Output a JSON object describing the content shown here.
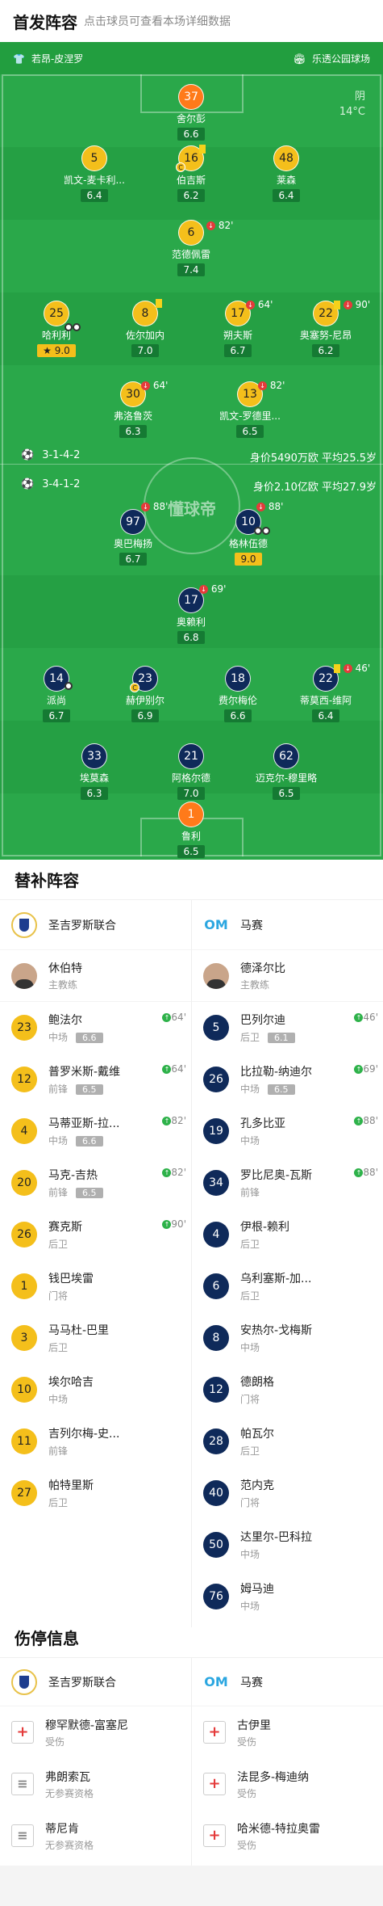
{
  "header": {
    "title": "首发阵容",
    "subtitle": "点击球员可查看本场详细数据"
  },
  "pitch": {
    "home_team_short": "若昂-皮涅罗",
    "venue": "乐透公园球场",
    "weather": "阴",
    "temperature": "14°C",
    "watermark": "懂球帝",
    "home_formation": "3-1-4-2",
    "away_formation": "3-4-1-2",
    "home_stats": "身价5490万欧  平均25.5岁",
    "away_stats": "身价2.10亿欧  平均27.9岁"
  },
  "home_players": [
    {
      "num": "37",
      "name": "舍尔彭",
      "rating": "6.6"
    },
    {
      "num": "5",
      "name": "凯文-麦卡利...",
      "rating": "6.4"
    },
    {
      "num": "16",
      "name": "伯吉斯",
      "rating": "6.2"
    },
    {
      "num": "48",
      "name": "莱森",
      "rating": "6.4"
    },
    {
      "num": "6",
      "name": "范德佩雷",
      "rating": "7.4",
      "event": "82'"
    },
    {
      "num": "25",
      "name": "哈利利",
      "rating": "9.0"
    },
    {
      "num": "8",
      "name": "佐尔加内",
      "rating": "7.0"
    },
    {
      "num": "17",
      "name": "朔夫斯",
      "rating": "6.7",
      "event": "64'"
    },
    {
      "num": "22",
      "name": "奥塞努-尼昂",
      "rating": "6.2",
      "event": "90'"
    },
    {
      "num": "30",
      "name": "弗洛鲁茨",
      "rating": "6.3",
      "event": "64'"
    },
    {
      "num": "13",
      "name": "凯文-罗德里...",
      "rating": "6.5",
      "event": "82'"
    }
  ],
  "away_players": [
    {
      "num": "97",
      "name": "奥巴梅扬",
      "rating": "6.7",
      "event": "88'"
    },
    {
      "num": "10",
      "name": "格林伍德",
      "rating": "9.0",
      "event": "88'"
    },
    {
      "num": "17",
      "name": "奥赖利",
      "rating": "6.8",
      "event": "69'"
    },
    {
      "num": "14",
      "name": "派尚",
      "rating": "6.7"
    },
    {
      "num": "23",
      "name": "赫伊别尔",
      "rating": "6.9"
    },
    {
      "num": "18",
      "name": "费尔梅伦",
      "rating": "6.6"
    },
    {
      "num": "22",
      "name": "蒂莫西-维阿",
      "rating": "6.4",
      "event": "46'"
    },
    {
      "num": "33",
      "name": "埃莫森",
      "rating": "6.3"
    },
    {
      "num": "21",
      "name": "阿格尔德",
      "rating": "7.0"
    },
    {
      "num": "62",
      "name": "迈克尔-穆里略",
      "rating": "6.5"
    },
    {
      "num": "1",
      "name": "鲁利",
      "rating": "6.5"
    }
  ],
  "subs": {
    "title": "替补阵容",
    "home_team": "圣吉罗斯联合",
    "away_team": "马赛",
    "away_logo": "OM",
    "home_coach": {
      "name": "休伯特",
      "role": "主教练"
    },
    "away_coach": {
      "name": "德泽尔比",
      "role": "主教练"
    },
    "home": [
      {
        "num": "23",
        "name": "鲍法尔",
        "pos": "中场",
        "rating": "6.6",
        "in": "64'"
      },
      {
        "num": "12",
        "name": "普罗米斯-戴维",
        "pos": "前锋",
        "rating": "6.5",
        "in": "64'"
      },
      {
        "num": "4",
        "name": "马蒂亚斯-拉...",
        "pos": "中场",
        "rating": "6.6",
        "in": "82'"
      },
      {
        "num": "20",
        "name": "马克-吉热",
        "pos": "前锋",
        "rating": "6.5",
        "in": "82'"
      },
      {
        "num": "26",
        "name": "赛克斯",
        "pos": "后卫",
        "in": "90'"
      },
      {
        "num": "1",
        "name": "钱巴埃雷",
        "pos": "门将"
      },
      {
        "num": "3",
        "name": "马马杜-巴里",
        "pos": "后卫"
      },
      {
        "num": "10",
        "name": "埃尔哈吉",
        "pos": "中场"
      },
      {
        "num": "11",
        "name": "吉列尔梅-史...",
        "pos": "前锋"
      },
      {
        "num": "27",
        "name": "帕特里斯",
        "pos": "后卫"
      }
    ],
    "away": [
      {
        "num": "5",
        "name": "巴列尔迪",
        "pos": "后卫",
        "rating": "6.1",
        "in": "46'"
      },
      {
        "num": "26",
        "name": "比拉勒-纳迪尔",
        "pos": "中场",
        "rating": "6.5",
        "in": "69'"
      },
      {
        "num": "19",
        "name": "孔多比亚",
        "pos": "中场",
        "in": "88'"
      },
      {
        "num": "34",
        "name": "罗比尼奥-瓦斯",
        "pos": "前锋",
        "in": "88'"
      },
      {
        "num": "4",
        "name": "伊根-赖利",
        "pos": "后卫"
      },
      {
        "num": "6",
        "name": "乌利塞斯-加...",
        "pos": "后卫"
      },
      {
        "num": "8",
        "name": "安热尔-戈梅斯",
        "pos": "中场"
      },
      {
        "num": "12",
        "name": "德朗格",
        "pos": "门将"
      },
      {
        "num": "28",
        "name": "帕瓦尔",
        "pos": "后卫"
      },
      {
        "num": "40",
        "name": "范内克",
        "pos": "门将"
      },
      {
        "num": "50",
        "name": "达里尔-巴科拉",
        "pos": "中场"
      },
      {
        "num": "76",
        "name": "姆马迪",
        "pos": "中场"
      }
    ]
  },
  "injuries": {
    "title": "伤停信息",
    "home": [
      {
        "name": "穆罕默德-富塞尼",
        "status": "受伤",
        "type": "injury"
      },
      {
        "name": "弗朗索瓦",
        "status": "无参赛资格",
        "type": "ineligible"
      },
      {
        "name": "蒂尼肯",
        "status": "无参赛资格",
        "type": "ineligible"
      }
    ],
    "away": [
      {
        "name": "古伊里",
        "status": "受伤",
        "type": "injury"
      },
      {
        "name": "法昆多-梅迪纳",
        "status": "受伤",
        "type": "injury"
      },
      {
        "name": "哈米德-特拉奥雷",
        "status": "受伤",
        "type": "injury"
      }
    ]
  }
}
